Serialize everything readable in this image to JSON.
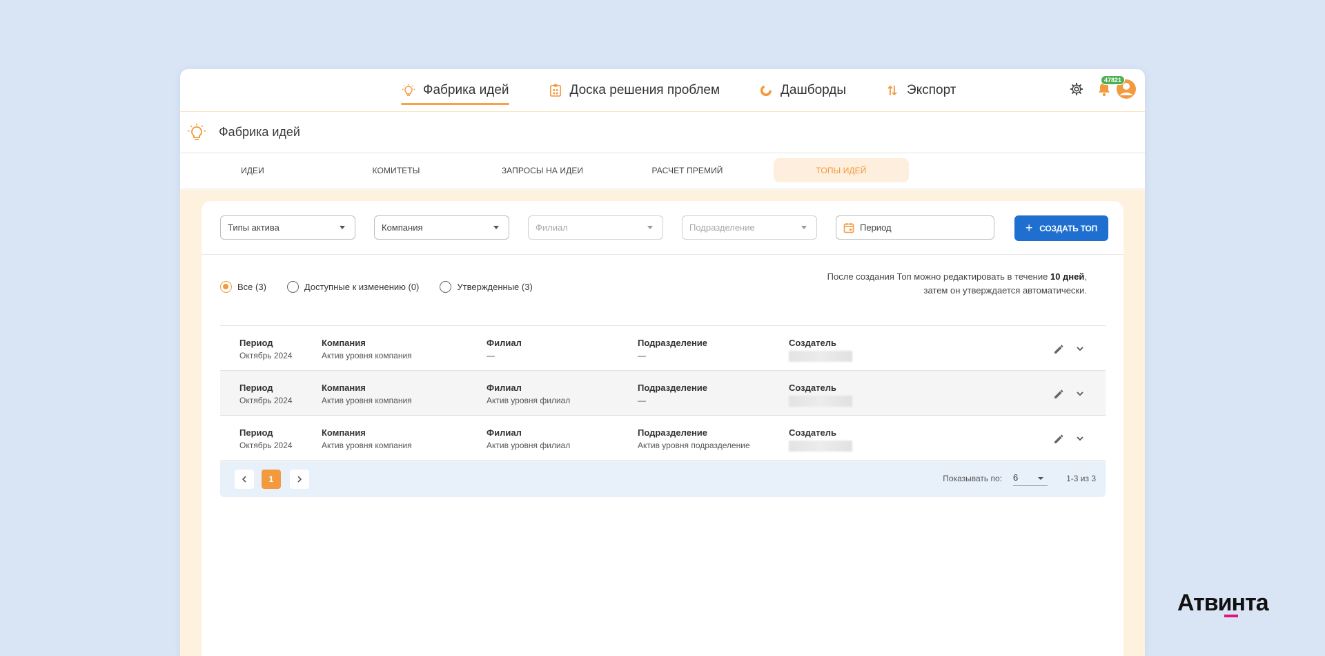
{
  "nav": {
    "items": [
      {
        "label": "Фабрика идей",
        "icon": "lightbulb-icon"
      },
      {
        "label": "Доска решения проблем",
        "icon": "board-icon"
      },
      {
        "label": "Дашборды",
        "icon": "dashboard-icon"
      },
      {
        "label": "Экспорт",
        "icon": "export-icon"
      }
    ],
    "notifications_badge": "47821"
  },
  "section": {
    "title": "Фабрика идей"
  },
  "tabs": [
    "ИДЕИ",
    "КОМИТЕТЫ",
    "ЗАПРОСЫ НА ИДЕИ",
    "РАСЧЕТ ПРЕМИЙ",
    "ТОПЫ ИДЕЙ"
  ],
  "active_tab": "ТОПЫ ИДЕЙ",
  "filters": {
    "asset_types": "Типы актива",
    "company": "Компания",
    "branch": "Филиал",
    "division": "Подразделение",
    "period": "Период"
  },
  "create_button": "СОЗДАТЬ ТОП",
  "radios": [
    {
      "label": "Все (3)",
      "selected": true
    },
    {
      "label": "Доступные к изменению (0)",
      "selected": false
    },
    {
      "label": "Утвержденные (3)",
      "selected": false
    }
  ],
  "note": {
    "line1_pre": "После создания Топ можно редактировать в течение ",
    "line1_bold": "10 дней",
    "line1_post": ",",
    "line2": "затем он утверждается автоматически."
  },
  "columns": {
    "period": "Период",
    "company": "Компания",
    "branch": "Филиал",
    "division": "Подразделение",
    "creator": "Создатель"
  },
  "rows": [
    {
      "period": "Октябрь 2024",
      "company": "Актив уровня компания",
      "branch": "—",
      "division": "—"
    },
    {
      "period": "Октябрь 2024",
      "company": "Актив уровня компания",
      "branch": "Актив уровня филиал",
      "division": "—"
    },
    {
      "period": "Октябрь 2024",
      "company": "Актив уровня компания",
      "branch": "Актив уровня филиал",
      "division": "Актив уровня подразделение"
    }
  ],
  "pagination": {
    "current_page": "1",
    "per_page_label": "Показывать по:",
    "per_page": "6",
    "range": "1-3 из 3"
  },
  "brand": "Атвинта",
  "colors": {
    "accent": "#f39a3f",
    "primary": "#1e6fd0",
    "badge": "#4caf50",
    "brand_underline": "#e6127a"
  }
}
